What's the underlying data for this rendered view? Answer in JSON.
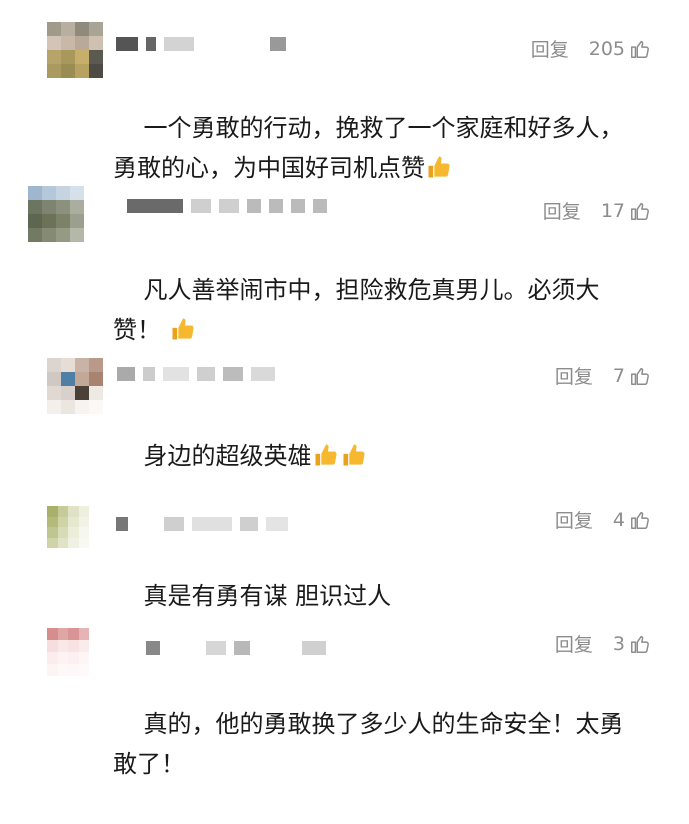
{
  "reply_label": "回复",
  "comments": [
    {
      "text": "一个勇敢的行动，挽救了一个家庭和好多人，\n勇敢的心，为中国好司机点赞",
      "likes": "205",
      "emoji": "thumbs-up-emoji"
    },
    {
      "text": "凡人善举闹市中，担险救危真男儿。必须大\n赞！",
      "likes": "17",
      "emoji": "thumbs-up-emoji"
    },
    {
      "text": "身边的超级英雄",
      "likes": "7",
      "emoji": "thumbs-up-emoji"
    },
    {
      "text": "真是有勇有谋 胆识过人",
      "likes": "4"
    },
    {
      "text": "真的，他的勇敢换了多少人的生命安全！太勇\n敢了！",
      "likes": "3"
    }
  ],
  "colors": {
    "meta_gray": "#8c8c8c",
    "text": "#1a1a1a",
    "name_blur": "#d3d3d3",
    "emoji_yellow": "#f5b82e"
  }
}
